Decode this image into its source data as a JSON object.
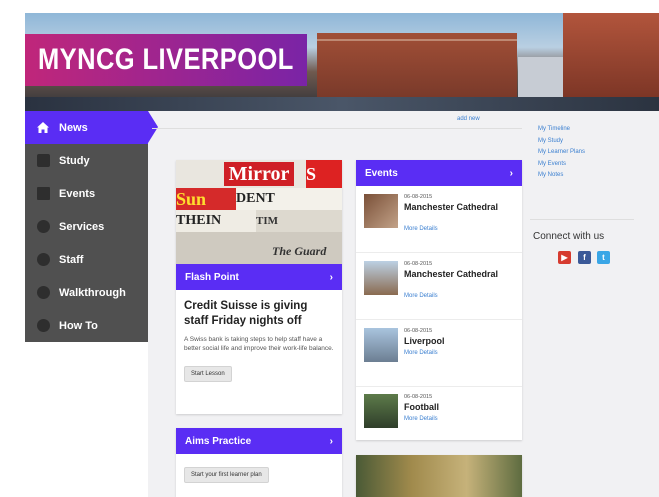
{
  "header": {
    "logo_text": "MYNCG LIVERPOOL"
  },
  "nav": {
    "items": [
      {
        "label": "News",
        "icon": "home-icon",
        "active": true
      },
      {
        "label": "Study",
        "icon": "study-icon",
        "active": false
      },
      {
        "label": "Events",
        "icon": "events-icon",
        "active": false
      },
      {
        "label": "Services",
        "icon": "services-icon",
        "active": false
      },
      {
        "label": "Staff",
        "icon": "staff-icon",
        "active": false
      },
      {
        "label": "Walkthrough",
        "icon": "walkthrough-icon",
        "active": false
      },
      {
        "label": "How To",
        "icon": "howto-icon",
        "active": false
      }
    ]
  },
  "main": {
    "add_new": "add new",
    "flash_point": {
      "bar_label": "Flash Point",
      "headline": "Credit Suisse is giving staff Friday nights off",
      "blurb": "A Swiss bank is taking steps to help staff have a better social life and improve their work-life balance.",
      "button": "Start Lesson"
    },
    "aims_practice": {
      "bar_label": "Aims Practice",
      "button": "Start your first learner plan"
    },
    "events": {
      "bar_label": "Events",
      "items": [
        {
          "date": "06-08-2015",
          "title": "Manchester Cathedral",
          "more": "More Details"
        },
        {
          "date": "06-08-2015",
          "title": "Manchester Cathedral",
          "more": "More Details"
        },
        {
          "date": "06-08-2015",
          "title": "Liverpool",
          "more": "More Details"
        },
        {
          "date": "06-08-2015",
          "title": "Football",
          "more": "More Details"
        }
      ]
    }
  },
  "right": {
    "links": [
      "My Timeline",
      "My Study",
      "My Learner Plans",
      "My Events",
      "My Notes"
    ],
    "connect_label": "Connect with us",
    "social": [
      {
        "icon": "youtube-icon",
        "color": "#d63b2f",
        "glyph": "▶"
      },
      {
        "icon": "facebook-icon",
        "color": "#3b5998",
        "glyph": "f"
      },
      {
        "icon": "twitter-icon",
        "color": "#3aa6e6",
        "glyph": "t"
      }
    ]
  },
  "colors": {
    "accent": "#5a2df4",
    "logo_from": "#c0267a",
    "logo_to": "#7a24a6",
    "nav_bg": "#505050"
  }
}
